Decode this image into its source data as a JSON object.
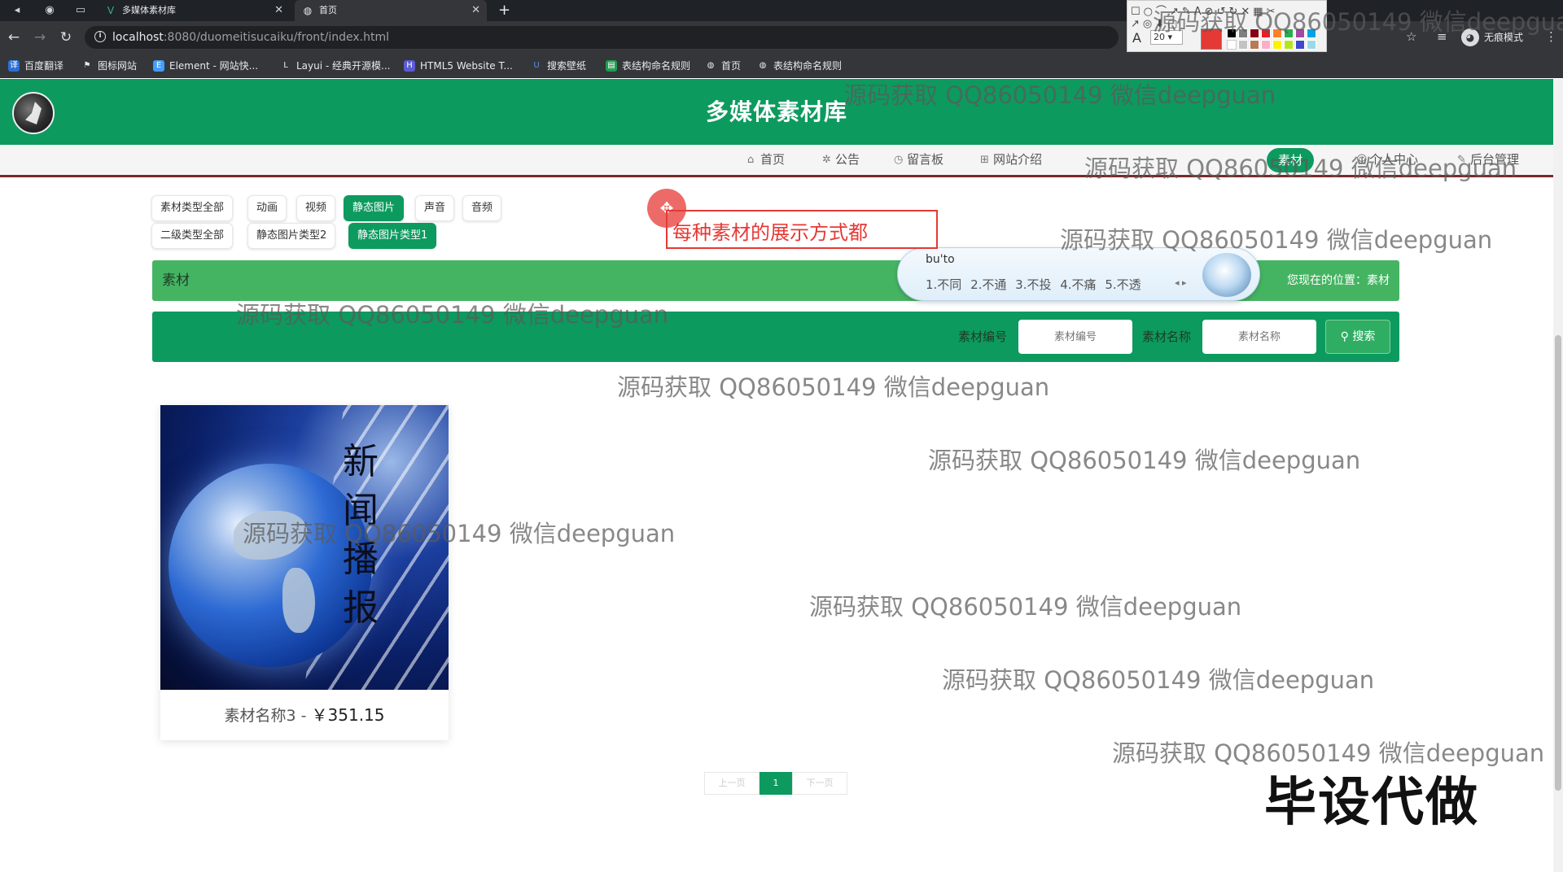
{
  "browser": {
    "tabs": [
      {
        "title": "多媒体素材库",
        "active": false
      },
      {
        "title": "首页",
        "active": true
      }
    ],
    "url_host": "localhost",
    "url_path": ":8080/duomeitisucaiku/front/index.html",
    "profile_label": "无痕模式",
    "bookmarks": [
      "百度翻译",
      "图标网站",
      "Element - 网站快...",
      "Layui - 经典开源模...",
      "HTML5 Website T...",
      "搜索壁纸",
      "表结构命名规则",
      "首页",
      "表结构命名规则"
    ]
  },
  "palette": {
    "font_size": "20",
    "current_color": "#e53935"
  },
  "site": {
    "title": "多媒体素材库",
    "nav": [
      "首页",
      "公告",
      "留言板",
      "网站介绍",
      "素材",
      "个人中心",
      "后台管理"
    ],
    "nav_active": "素材"
  },
  "categories": {
    "row1": [
      {
        "label": "素材类型全部",
        "active": false
      },
      {
        "label": "动画",
        "active": false
      },
      {
        "label": "视频",
        "active": false
      },
      {
        "label": "静态图片",
        "active": true
      },
      {
        "label": "声音",
        "active": false
      },
      {
        "label": "音频",
        "active": false
      }
    ],
    "row2": [
      {
        "label": "二级类型全部",
        "active": false
      },
      {
        "label": "静态图片类型2",
        "active": false
      },
      {
        "label": "静态图片类型1",
        "active": true
      }
    ]
  },
  "breadcrumb": {
    "title": "素材",
    "location_label": "您现在的位置：素材"
  },
  "ime": {
    "composition": "bu'to",
    "candidates": "1.不同 2.不通 3.不投 4.不痛 5.不透"
  },
  "search": {
    "code_label": "素材编号",
    "code_placeholder": "素材编号",
    "name_label": "素材名称",
    "name_placeholder": "素材名称",
    "button_label": "搜索"
  },
  "items": [
    {
      "name": "素材名称3",
      "separator": "-",
      "price": "￥351.15",
      "image_text": "新闻播报"
    }
  ],
  "pagination": {
    "prev": "上一页",
    "current": "1",
    "next": "下一页"
  },
  "annotation": {
    "text": "每种素材的展示方式都"
  },
  "watermark": {
    "text": "源码获取 QQ86050149 微信deepguan",
    "big_text": "毕设代做"
  }
}
